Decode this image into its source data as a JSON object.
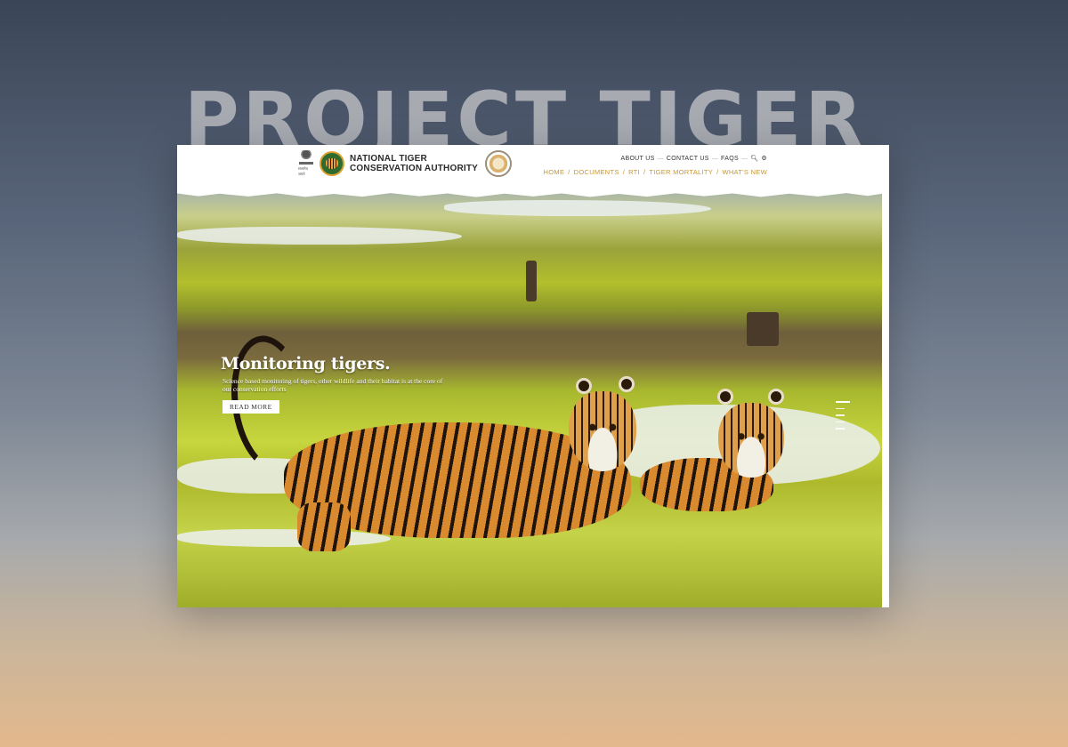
{
  "page_title": "PROJECT TIGER",
  "site": {
    "org_name_line1": "NATIONAL TIGER",
    "org_name_line2": "CONSERVATION AUTHORITY",
    "emblem_motto": "सत्यमेव जयते"
  },
  "top_links": [
    "ABOUT US",
    "CONTACT US",
    "FAQS"
  ],
  "top_separator": "—",
  "icons": {
    "search": "search-icon",
    "settings": "gear-icon"
  },
  "main_nav": [
    "HOME",
    "DOCUMENTS",
    "RTI",
    "TIGER MORTALITY",
    "WHAT'S NEW"
  ],
  "nav_separator": "/",
  "hero": {
    "title": "Monitoring tigers.",
    "text": "Science based monitoring of tigers, other wildlife and their habitat is at the core of our conservation efforts",
    "button": "READ MORE",
    "slide_count": 5,
    "active_slide": 1
  },
  "colors": {
    "nav_accent": "#c9962f",
    "header_bg": "#ffffff",
    "logo_green": "#2f6b2c"
  }
}
